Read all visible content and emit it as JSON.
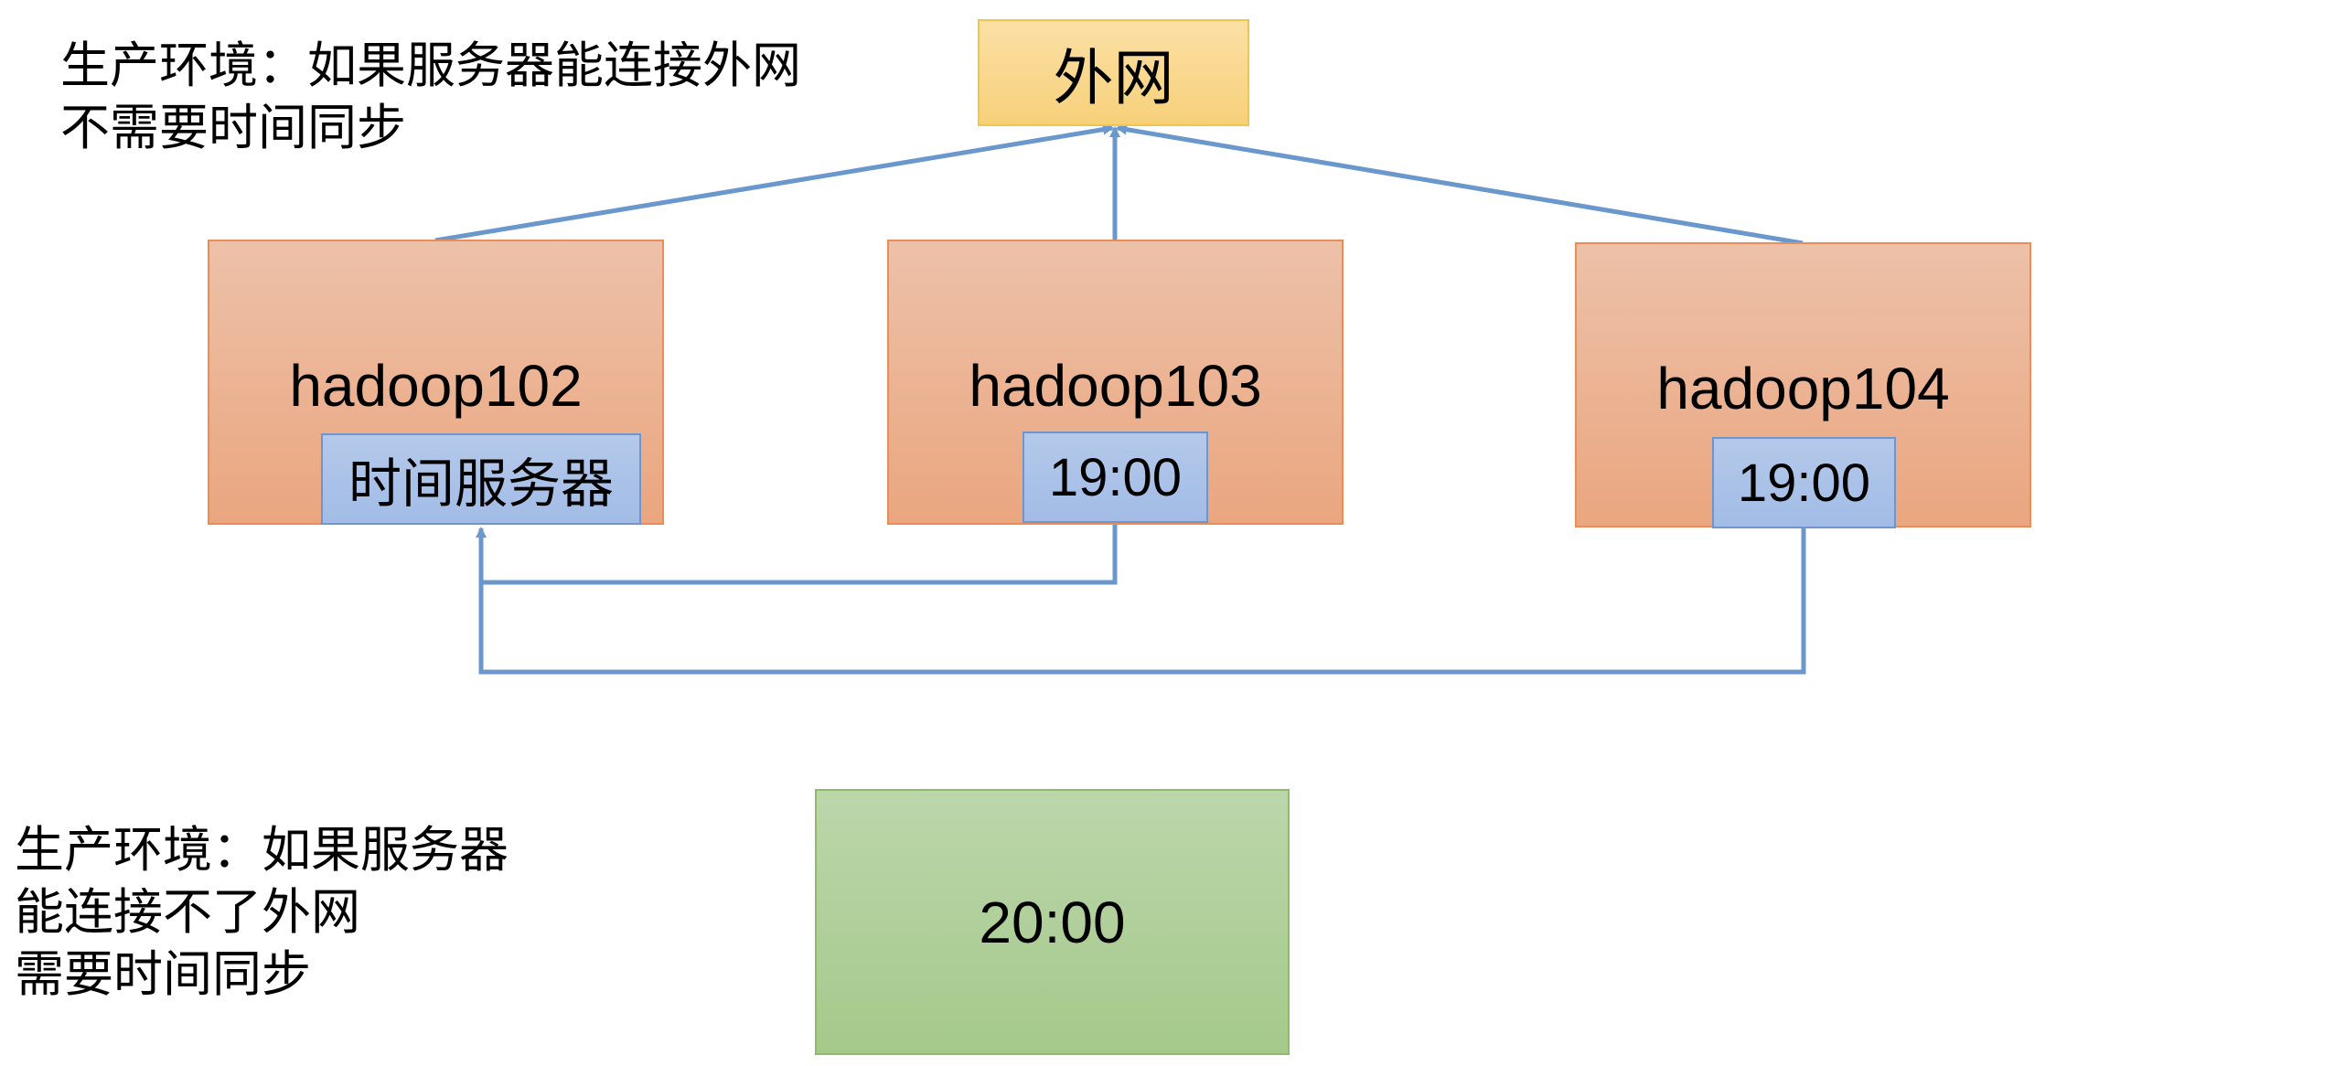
{
  "note_top": {
    "line1": "生产环境：如果服务器能连接外网",
    "line2": "不需要时间同步"
  },
  "internet": {
    "label": "外网"
  },
  "servers": [
    {
      "name": "hadoop102",
      "clock": "时间服务器"
    },
    {
      "name": "hadoop103",
      "clock": "19:00"
    },
    {
      "name": "hadoop104",
      "clock": "19:00"
    }
  ],
  "note_bottom": {
    "line1": "生产环境：如果服务器",
    "line2": "能连接不了外网",
    "line3": "需要时间同步"
  },
  "local_clock": {
    "label": "20:00"
  },
  "colors": {
    "connector": "#6a98cc",
    "server_fill": "#eaa67f",
    "server_border": "#ea8d57",
    "clock_fill": "#a2bce6",
    "internet_fill": "#f7d17a",
    "local_fill": "#a5c98b"
  }
}
